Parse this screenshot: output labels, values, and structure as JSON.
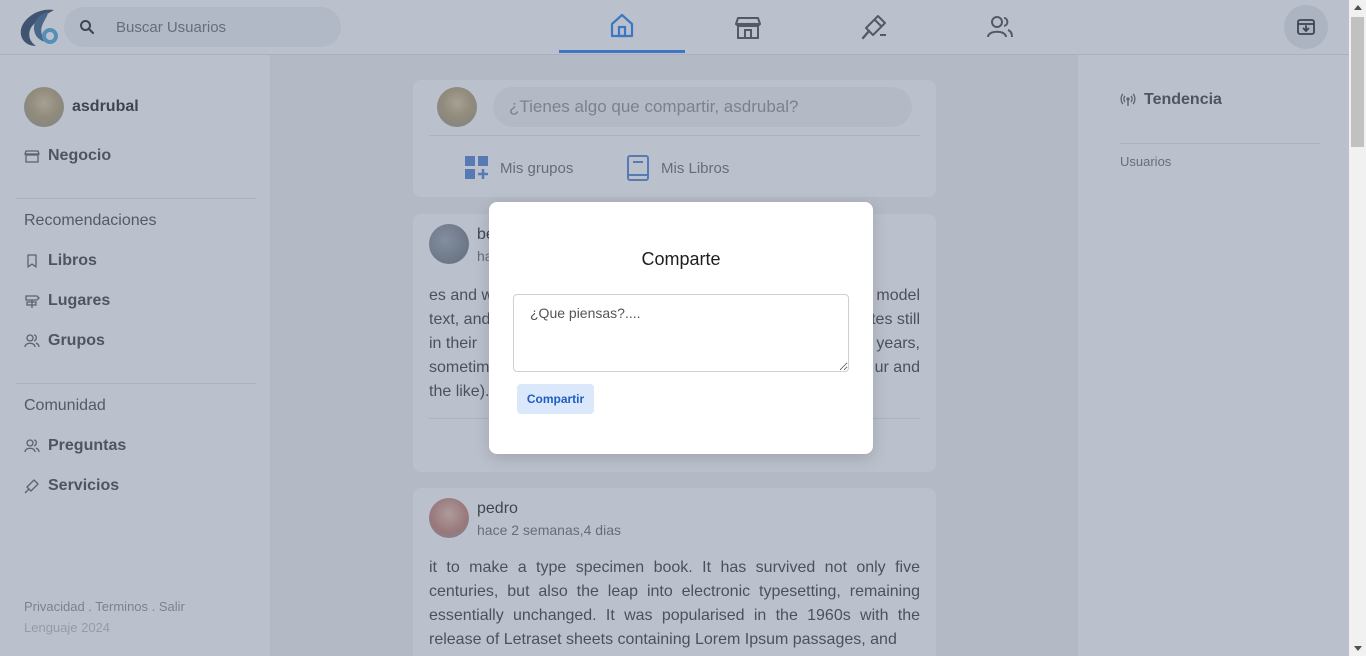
{
  "search": {
    "placeholder": "Buscar Usuarios"
  },
  "nav": {
    "tabs": [
      "home",
      "store",
      "services",
      "users"
    ],
    "active": "home"
  },
  "colors": {
    "accent": "#1877f2",
    "overlay": "#68758f",
    "button_bg": "#dbe7fb",
    "button_text": "#1d5fc4"
  },
  "user": {
    "name": "asdrubal"
  },
  "sidebar": {
    "business": "Negocio",
    "recommendations": {
      "title": "Recomendaciones",
      "items": [
        "Libros",
        "Lugares",
        "Grupos"
      ]
    },
    "community": {
      "title": "Comunidad",
      "items": [
        "Preguntas",
        "Servicios"
      ]
    },
    "footer": "Privacidad . Terminos . Salir",
    "copyright": "Lenguaje 2024"
  },
  "right": {
    "trend": "Tendencia",
    "users": "Usuarios"
  },
  "composer": {
    "prompt": "¿Tienes algo que compartir, asdrubal?",
    "actions": [
      "Mis grupos",
      "Mis Libros"
    ]
  },
  "posts": [
    {
      "author": "be",
      "time": "ha",
      "text_left": [
        "es and w",
        "text, and",
        "in  their",
        "sometim",
        "the like)."
      ],
      "text_right": [
        "model",
        "tes still",
        "years,",
        "ur and",
        ""
      ]
    },
    {
      "author": "pedro",
      "time": "hace 2 semanas,4 dias",
      "text": "it to make a type specimen book. It has survived not only five centuries, but also the leap into electronic typesetting, remaining essentially unchanged. It was popularised in the 1960s with the release of Letraset sheets containing Lorem Ipsum passages, and"
    }
  ],
  "modal": {
    "title": "Comparte",
    "placeholder": "¿Que piensas?....",
    "button": "Compartir"
  }
}
